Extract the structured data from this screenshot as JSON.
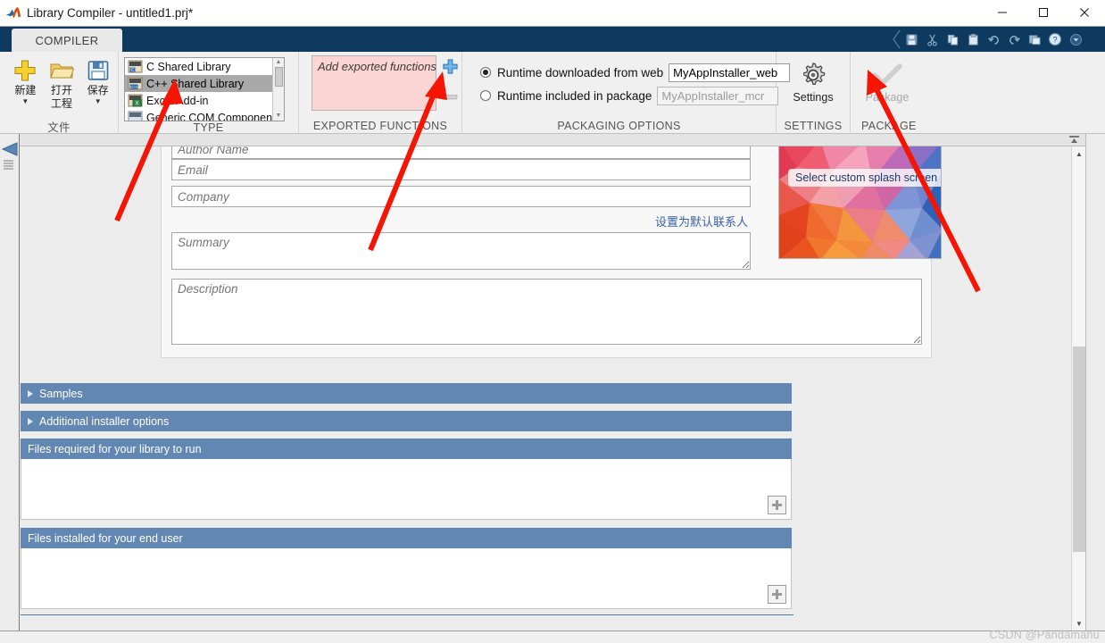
{
  "window": {
    "title": "Library Compiler - untitled1.prj*",
    "app_icon": "matlab-logo-icon",
    "minimize_label": "—",
    "maximize_label": "□",
    "close_label": "✕"
  },
  "quick_access": {
    "items": [
      {
        "name": "save-icon",
        "title": "Save"
      },
      {
        "name": "cut-icon",
        "title": "Cut"
      },
      {
        "name": "copy-icon",
        "title": "Copy"
      },
      {
        "name": "paste-icon",
        "title": "Paste"
      },
      {
        "name": "undo-icon",
        "title": "Undo"
      },
      {
        "name": "redo-icon",
        "title": "Redo"
      },
      {
        "name": "window-layout-icon",
        "title": "Layout"
      },
      {
        "name": "help-icon",
        "title": "Help"
      },
      {
        "name": "dropdown-icon",
        "title": "More"
      }
    ]
  },
  "ribbon": {
    "tab_label": "COMPILER",
    "file_group": {
      "label": "文件",
      "buttons": [
        {
          "name": "new-project-button",
          "icon": "plus-icon",
          "line1": "新建",
          "line2": "",
          "has_caret": true
        },
        {
          "name": "open-project-button",
          "icon": "folder-icon",
          "line1": "打开",
          "line2": "工程",
          "has_caret": false
        },
        {
          "name": "save-project-button",
          "icon": "floppy-icon",
          "line1": "保存",
          "line2": "",
          "has_caret": true
        }
      ]
    },
    "type_group": {
      "label": "TYPE",
      "items": [
        {
          "label": "C Shared Library",
          "selected": false,
          "icon": "c-library-icon"
        },
        {
          "label": "C++ Shared Library",
          "selected": true,
          "icon": "cpp-library-icon"
        },
        {
          "label": "Excel Add-in",
          "selected": false,
          "icon": "excel-addin-icon"
        },
        {
          "label": "Generic COM Component",
          "selected": false,
          "icon": "com-component-icon"
        }
      ]
    },
    "exported_functions": {
      "label": "EXPORTED FUNCTIONS",
      "placeholder": "Add exported functions",
      "add_button": "add-function-button",
      "remove_button": "remove-function-button"
    },
    "packaging_options": {
      "label": "PACKAGING OPTIONS",
      "option_web": {
        "label": "Runtime downloaded from web",
        "selected": true,
        "value": "MyAppInstaller_web"
      },
      "option_included": {
        "label": "Runtime included in package",
        "selected": false,
        "value": "MyAppInstaller_mcr"
      }
    },
    "settings_group": {
      "label": "SETTINGS",
      "button_label": "Settings",
      "icon": "gear-icon"
    },
    "package_group": {
      "label": "PACKAGE",
      "button_label": "Package",
      "icon": "checkmark-icon",
      "disabled": true
    }
  },
  "form": {
    "author_placeholder": "Author Name",
    "email_placeholder": "Email",
    "company_placeholder": "Company",
    "summary_placeholder": "Summary",
    "description_placeholder": "Description",
    "default_contact_link": "设置为默认联系人"
  },
  "splash": {
    "button_label": "Select custom splash screen",
    "colors": [
      "#e8475e",
      "#f06a7c",
      "#ec8fae",
      "#f4a0b8",
      "#e9564a",
      "#f0693a",
      "#f7923a",
      "#e64b35",
      "#d94fa0",
      "#b65cb0",
      "#8f6fc0",
      "#7b87ce",
      "#6f9ad8",
      "#5f86cc",
      "#3f6fc0",
      "#2e62b8"
    ]
  },
  "sections": [
    {
      "name": "samples-section",
      "title": "Samples",
      "collapsible": true,
      "expanded": false
    },
    {
      "name": "additional-installer-options-section",
      "title": "Additional installer options",
      "collapsible": true,
      "expanded": false
    },
    {
      "name": "files-required-section",
      "title": "Files required for your library to run",
      "collapsible": false,
      "expanded": true,
      "add_button": "add-required-file-button"
    },
    {
      "name": "files-installed-section",
      "title": "Files installed for your end user",
      "collapsible": false,
      "expanded": true,
      "add_button": "add-installed-file-button"
    }
  ],
  "status": {
    "watermark": "CSDN @Pandamahu"
  },
  "theme": {
    "ribbon_blue": "#0e3a5f",
    "section_blue": "#6287b2",
    "link_blue": "#3a62a8",
    "exported_bg": "#fbd4d4",
    "annotation_red": "#f51505"
  }
}
